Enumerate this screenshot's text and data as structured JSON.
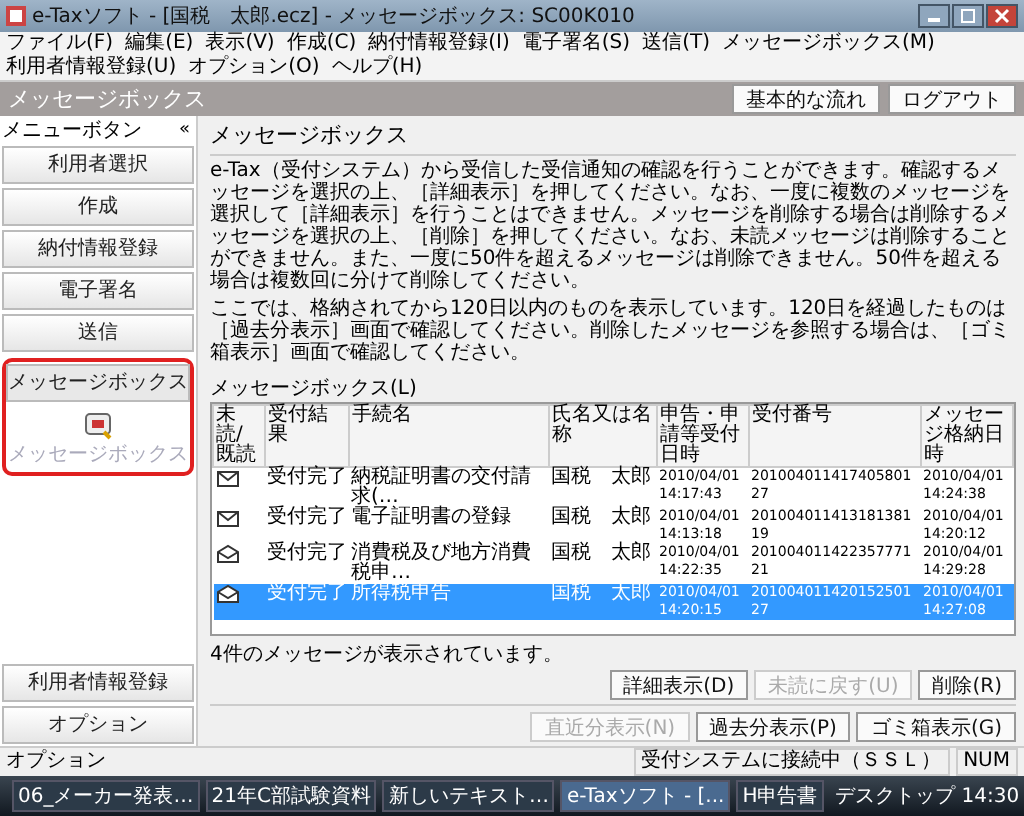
{
  "window": {
    "title": "e-Taxソフト - [国税　太郎.ecz] - メッセージボックス: SC00K010"
  },
  "menu": [
    "ファイル(F)",
    "編集(E)",
    "表示(V)",
    "作成(C)",
    "納付情報登録(I)",
    "電子署名(S)",
    "送信(T)",
    "メッセージボックス(M)",
    "利用者情報登録(U)",
    "オプション(O)",
    "ヘルプ(H)"
  ],
  "header": {
    "title": "メッセージボックス",
    "buttons": [
      "基本的な流れ",
      "ログアウト"
    ]
  },
  "sidebar": {
    "title": "メニューボタン",
    "collapse": "«",
    "items": [
      {
        "label": "利用者選択",
        "selected": false
      },
      {
        "label": "作成",
        "selected": false
      },
      {
        "label": "納付情報登録",
        "selected": false
      },
      {
        "label": "電子署名",
        "selected": false
      },
      {
        "label": "送信",
        "selected": false
      },
      {
        "label": "メッセージボックス",
        "selected": true,
        "sub_label": "メッセージボックス"
      }
    ],
    "bottom_items": [
      "利用者情報登録",
      "オプション"
    ]
  },
  "content": {
    "title": "メッセージボックス",
    "paragraphs": [
      "e-Tax（受付システム）から受信した受信通知の確認を行うことができます。確認するメッセージを選択の上、［詳細表示］を押してください。なお、一度に複数のメッセージを選択して［詳細表示］を行うことはできません。メッセージを削除する場合は削除するメッセージを選択の上、［削除］を押してください。なお、未読メッセージは削除することができません。また、一度に50件を超えるメッセージは削除できません。50件を超える場合は複数回に分けて削除してください。",
      "ここでは、格納されてから120日以内のものを表示しています。120日を経過したものは［過去分表示］画面で確認してください。削除したメッセージを参照する場合は、［ゴミ箱表示］画面で確認してください。"
    ],
    "list_label": "メッセージボックス(L)",
    "columns": [
      "未読/既読",
      "受付結果",
      "手続名",
      "氏名又は名称",
      "申告・申請等受付日時",
      "受付番号",
      "メッセージ格納日時"
    ],
    "rows": [
      {
        "read": false,
        "selected": false,
        "cells": [
          "",
          "受付完了",
          "納税証明書の交付請求(…",
          "国税　太郎",
          "2010/04/01 14:17:43",
          "20100401141740580127",
          "2010/04/01 14:24:38"
        ]
      },
      {
        "read": false,
        "selected": false,
        "cells": [
          "",
          "受付完了",
          "電子証明書の登録",
          "国税　太郎",
          "2010/04/01 14:13:18",
          "20100401141318138119",
          "2010/04/01 14:20:12"
        ]
      },
      {
        "read": true,
        "selected": false,
        "cells": [
          "",
          "受付完了",
          "消費税及び地方消費税申…",
          "国税　太郎",
          "2010/04/01 14:22:35",
          "20100401142235777121",
          "2010/04/01 14:29:28"
        ]
      },
      {
        "read": true,
        "selected": true,
        "cells": [
          "",
          "受付完了",
          "所得税申告",
          "国税　太郎",
          "2010/04/01 14:20:15",
          "20100401142015250127",
          "2010/04/01 14:27:08"
        ]
      }
    ],
    "count_text": "4件のメッセージが表示されています。",
    "buttons_row1": [
      {
        "label": "詳細表示(D)",
        "disabled": false
      },
      {
        "label": "未読に戻す(U)",
        "disabled": true
      },
      {
        "label": "削除(R)",
        "disabled": false
      }
    ],
    "buttons_row2": [
      {
        "label": "直近分表示(N)",
        "disabled": true
      },
      {
        "label": "過去分表示(P)",
        "disabled": false
      },
      {
        "label": "ゴミ箱表示(G)",
        "disabled": false
      }
    ]
  },
  "status_bar": {
    "left": "オプション",
    "connection": "受付システムに接続中（ＳＳＬ）",
    "num": "NUM"
  },
  "taskbar": {
    "items": [
      {
        "label": "06_メーカー発表…",
        "selected": false
      },
      {
        "label": "21年C部試験資料",
        "selected": false
      },
      {
        "label": "新しいテキスト…",
        "selected": false
      },
      {
        "label": "e-Taxソフト - [...",
        "selected": true
      },
      {
        "label": "H申告書",
        "selected": false
      }
    ],
    "desktop": "デスクトップ",
    "time": "14:30"
  }
}
